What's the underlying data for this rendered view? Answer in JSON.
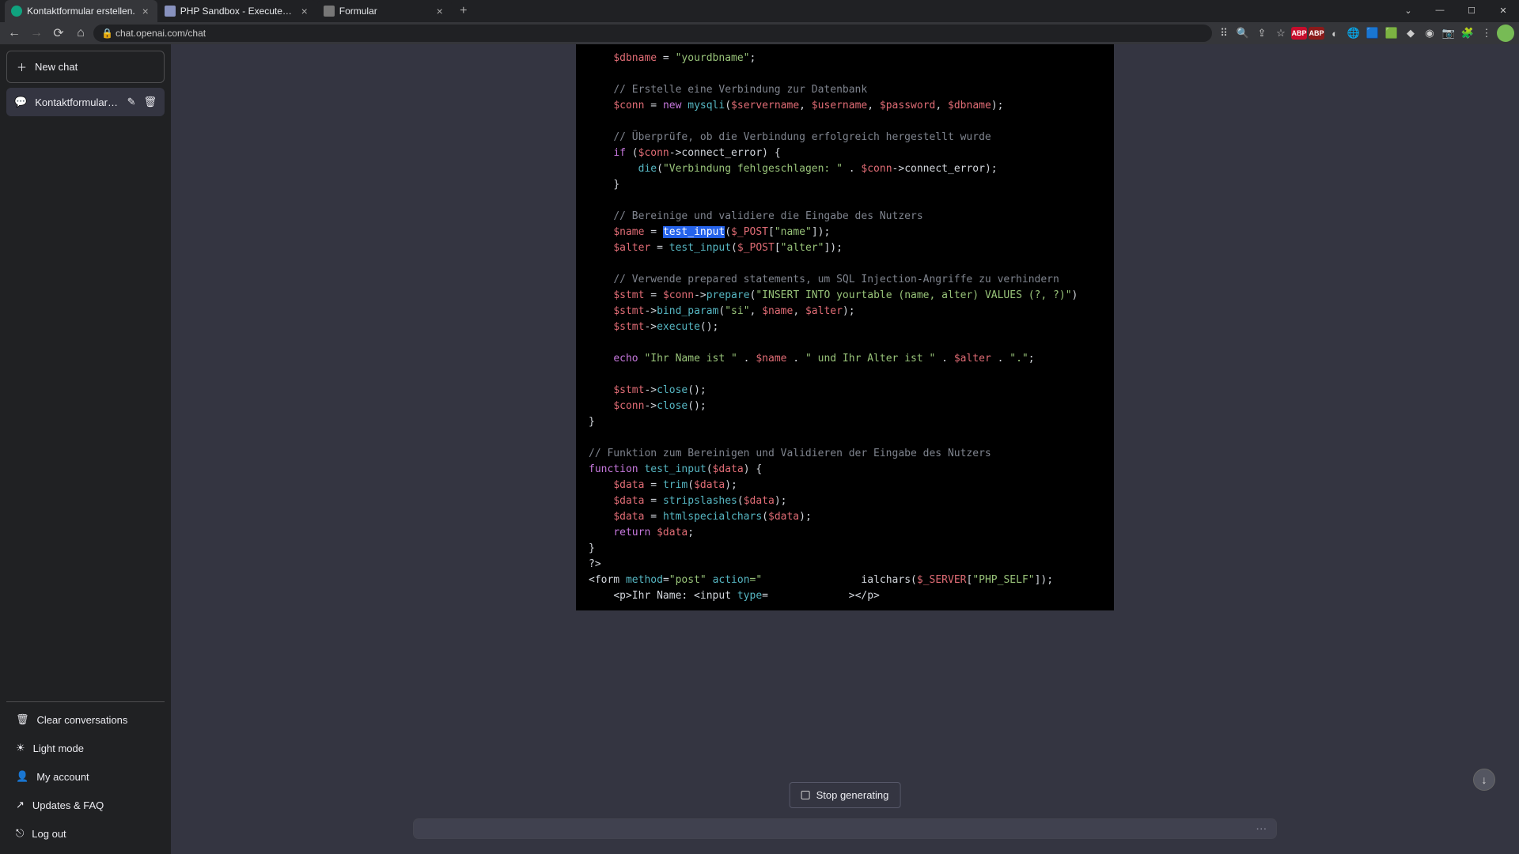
{
  "browser": {
    "tabs": [
      {
        "title": "Kontaktformular erstellen.",
        "active": true
      },
      {
        "title": "PHP Sandbox - Execute PHP cod",
        "active": false
      },
      {
        "title": "Formular",
        "active": false
      }
    ],
    "url": "chat.openai.com/chat"
  },
  "sidebar": {
    "new_chat": "New chat",
    "conversation": "Kontaktformular erstell",
    "clear": "Clear conversations",
    "light": "Light mode",
    "account": "My account",
    "updates": "Updates & FAQ",
    "logout": "Log out"
  },
  "code": {
    "l1a": "$dbname",
    "l1b": " = ",
    "l1c": "\"yourdbname\"",
    "l1d": ";",
    "l2": "// Erstelle eine Verbindung zur Datenbank",
    "l3a": "$conn",
    "l3b": " = ",
    "l3c": "new",
    "l3d": " mysqli",
    "l3e": "(",
    "l3f": "$servername",
    "l3g": ", ",
    "l3h": "$username",
    "l3i": ", ",
    "l3j": "$password",
    "l3k": ", ",
    "l3l": "$dbname",
    "l3m": ");",
    "l4": "// Überprüfe, ob die Verbindung erfolgreich hergestellt wurde",
    "l5a": "if",
    "l5b": " (",
    "l5c": "$conn",
    "l5d": "->connect_error) {",
    "l6a": "die",
    "l6b": "(",
    "l6c": "\"Verbindung fehlgeschlagen: \"",
    "l6d": " . ",
    "l6e": "$conn",
    "l6f": "->connect_error);",
    "l7": "}",
    "l8": "// Bereinige und validiere die Eingabe des Nutzers",
    "l9a": "$name",
    "l9b": " = ",
    "l9c": "test_input",
    "l9d": "(",
    "l9e": "$_POST",
    "l9f": "[",
    "l9g": "\"name\"",
    "l9h": "]);",
    "l10a": "$alter",
    "l10b": " = ",
    "l10c": "test_input",
    "l10d": "(",
    "l10e": "$_POST",
    "l10f": "[",
    "l10g": "\"alter\"",
    "l10h": "]);",
    "l11": "// Verwende prepared statements, um SQL Injection-Angriffe zu verhindern",
    "l12a": "$stmt",
    "l12b": " = ",
    "l12c": "$conn",
    "l12d": "->",
    "l12e": "prepare",
    "l12f": "(",
    "l12g": "\"INSERT INTO yourtable (name, alter) VALUES (?, ?)\"",
    "l12h": ")",
    "l13a": "$stmt",
    "l13b": "->",
    "l13c": "bind_param",
    "l13d": "(",
    "l13e": "\"si\"",
    "l13f": ", ",
    "l13g": "$name",
    "l13h": ", ",
    "l13i": "$alter",
    "l13j": ");",
    "l14a": "$stmt",
    "l14b": "->",
    "l14c": "execute",
    "l14d": "();",
    "l15a": "echo",
    "l15b": " ",
    "l15c": "\"Ihr Name ist \"",
    "l15d": " . ",
    "l15e": "$name",
    "l15f": " . ",
    "l15g": "\" und Ihr Alter ist \"",
    "l15h": " . ",
    "l15i": "$alter",
    "l15j": " . ",
    "l15k": "\".\"",
    "l15l": ";",
    "l16a": "$stmt",
    "l16b": "->",
    "l16c": "close",
    "l16d": "();",
    "l17a": "$conn",
    "l17b": "->",
    "l17c": "close",
    "l17d": "();",
    "l18": "}",
    "l19": "// Funktion zum Bereinigen und Validieren der Eingabe des Nutzers",
    "l20a": "function",
    "l20b": " test_input",
    "l20c": "(",
    "l20d": "$data",
    "l20e": ") {",
    "l21a": "$data",
    "l21b": " = ",
    "l21c": "trim",
    "l21d": "(",
    "l21e": "$data",
    "l21f": ");",
    "l22a": "$data",
    "l22b": " = ",
    "l22c": "stripslashes",
    "l22d": "(",
    "l22e": "$data",
    "l22f": ");",
    "l23a": "$data",
    "l23b": " = ",
    "l23c": "htmlspecialchars",
    "l23d": "(",
    "l23e": "$data",
    "l23f": ");",
    "l24a": "return",
    "l24b": " ",
    "l24c": "$data",
    "l24d": ";",
    "l25": "}",
    "l26": "?>",
    "l27a": "<form ",
    "l27b": "method",
    "l27c": "=",
    "l27d": "\"post\"",
    "l27e": " ",
    "l27f": "action",
    "l27g": "=\"",
    "l27h": "ialchars(",
    "l27i": "$_SERVER",
    "l27j": "[",
    "l27k": "\"PHP_SELF\"",
    "l27l": "]);",
    "l28a": "<p>Ihr Name: <input ",
    "l28b": "type",
    "l28c": "=",
    "l28d": "></p>"
  },
  "stop_generating": "Stop generating"
}
